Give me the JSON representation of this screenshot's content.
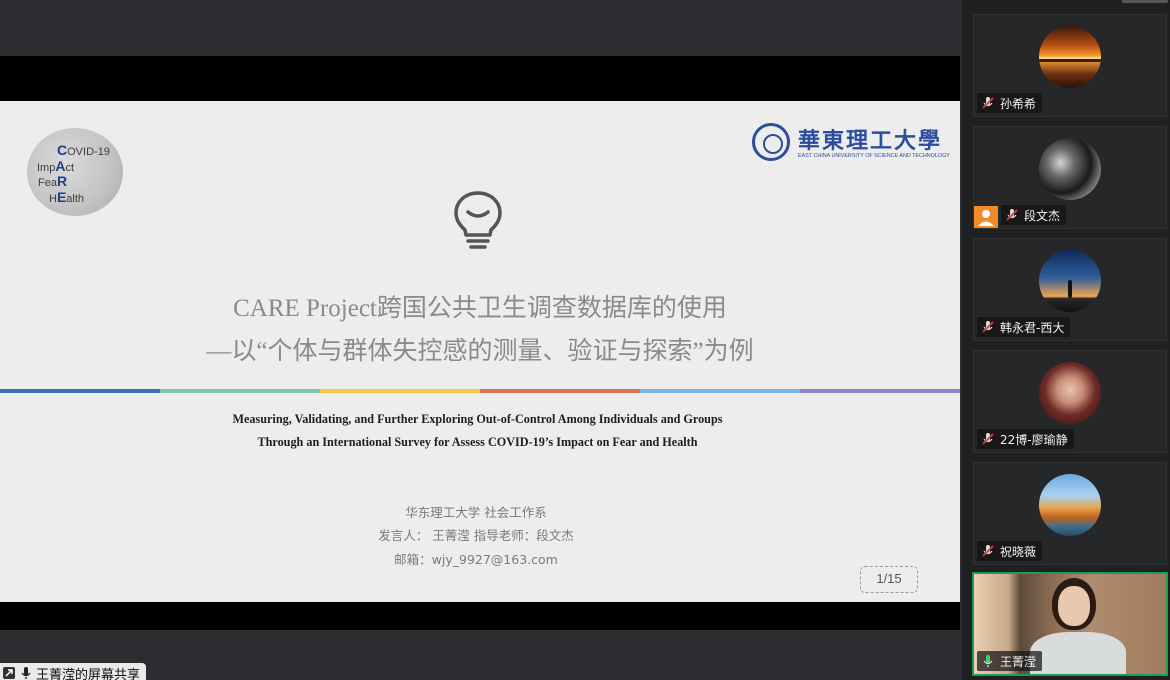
{
  "slide": {
    "care_logo": [
      "COVID-19",
      "ImpAct",
      "FeaR",
      "HEalth"
    ],
    "university": {
      "name_cn": "華東理工大學",
      "name_en": "EAST CHINA UNIVERSITY OF SCIENCE AND TECHNOLOGY"
    },
    "title_line1": "CARE Project跨国公共卫生调查数据库的使用",
    "title_line2": "—以“个体与群体失控感的测量、验证与探索”为例",
    "color_bar": [
      "#3d6fb1",
      "#7cc4b6",
      "#f2c94c",
      "#e0734f",
      "#79b7e8",
      "#8e86c8"
    ],
    "english_title_line1": "Measuring, Validating, and Further Exploring Out-of-Control Among Individuals and Groups",
    "english_title_line2": "Through an International Survey for Assess COVID-19’s Impact on Fear and Health",
    "info_line1": "华东理工大学 社会工作系",
    "info_line2": "发言人： 王菁滢    指导老师：段文杰",
    "info_line3": "邮箱：wjy_9927@163.com",
    "page_number": "1/15"
  },
  "share_caption": "王菁滢的屏幕共享",
  "participants": [
    {
      "name": "孙希希",
      "mic": "muted",
      "avatar": "sunset-sea"
    },
    {
      "name": "段文杰",
      "mic": "muted",
      "avatar": "dark-flowers",
      "host": true
    },
    {
      "name": "韩永君-西大",
      "mic": "muted",
      "avatar": "silhouette-dusk"
    },
    {
      "name": "22博-廖瑜静",
      "mic": "muted",
      "avatar": "portrait-woman"
    },
    {
      "name": "祝晓薇",
      "mic": "muted",
      "avatar": "autumn-landscape"
    },
    {
      "name": "王菁滢",
      "mic": "active",
      "avatar": "live-video"
    }
  ]
}
